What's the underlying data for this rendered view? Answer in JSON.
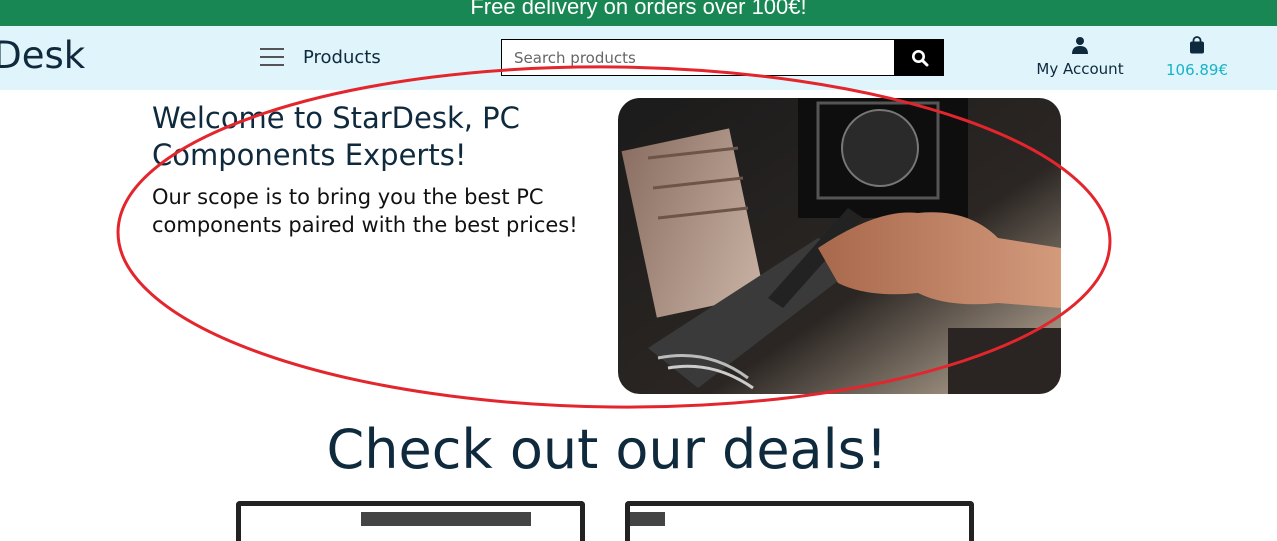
{
  "banner": {
    "text": "Free delivery on orders over 100€!"
  },
  "header": {
    "logo": "rDesk",
    "menu_label": "Products",
    "search": {
      "placeholder": "Search products",
      "value": ""
    },
    "account_label": "My Account",
    "cart_total": "106.89€"
  },
  "hero": {
    "title": "Welcome to StarDesk, PC Components Experts!",
    "subtitle": "Our scope is to bring you the best PC components paired with the best prices!",
    "image_subject": "hand-installing-pc-component-photo"
  },
  "deals": {
    "title": "Check out our deals!"
  },
  "colors": {
    "banner": "#198754",
    "header_bg": "#e0f4fb",
    "text_dark": "#0f2a3d",
    "cart_accent": "#17b3c8",
    "annotation": "#e3262d"
  },
  "icons": [
    "menu-icon",
    "search-icon",
    "user-icon",
    "shopping-bag-icon"
  ]
}
